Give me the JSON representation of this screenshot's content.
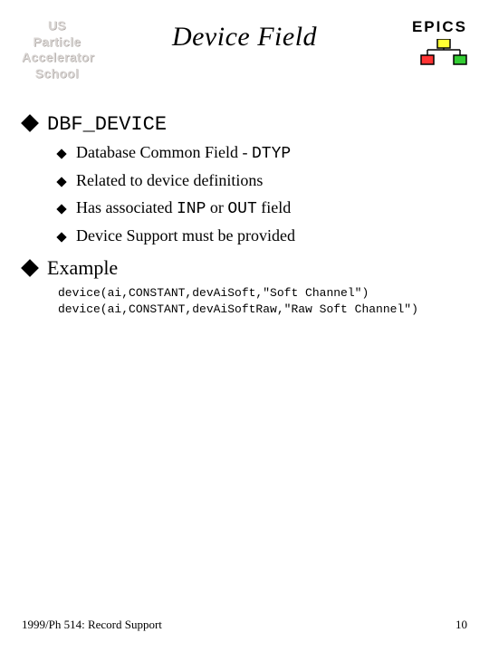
{
  "header": {
    "left_logo_lines": [
      "US",
      "Particle",
      "Accelerator",
      "School"
    ],
    "title": "Device Field",
    "right_label": "EPICS"
  },
  "section1": {
    "heading": "DBF_DEVICE",
    "items": [
      {
        "pre": "Database Common Field - ",
        "mono": "DTYP",
        "post": ""
      },
      {
        "pre": "Related to device definitions",
        "mono": "",
        "post": ""
      },
      {
        "pre": "Has associated ",
        "mono": "INP",
        "mid": " or ",
        "mono2": "OUT",
        "post": " field"
      },
      {
        "pre": "Device Support must be provided",
        "mono": "",
        "post": ""
      }
    ]
  },
  "section2": {
    "heading": "Example",
    "code": "device(ai,CONSTANT,devAiSoft,\"Soft Channel\")\ndevice(ai,CONSTANT,devAiSoftRaw,\"Raw Soft Channel\")"
  },
  "footer": {
    "left": "1999/Ph 514: Record Support",
    "right": "10"
  }
}
